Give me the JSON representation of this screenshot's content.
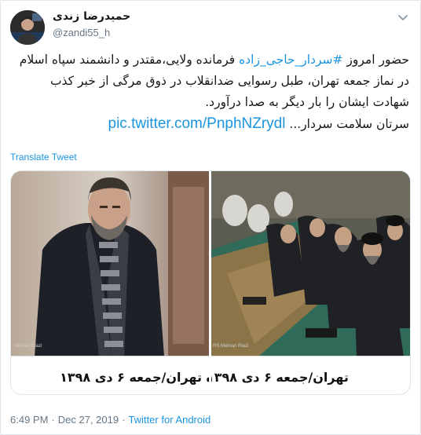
{
  "author": {
    "name": "حمیدرضا زندی",
    "handle": "@zandi55_h"
  },
  "tweet": {
    "part1": "حضور امروز ",
    "hashtag": "#سردار_حاجی_زاده",
    "part2": " فرمانده ولایی،مقتدر و دانشمند سپاه اسلام در نماز جمعه تهران، طبل رسوایی ضدانقلاب در ذوق مرگی از خبر کذب شهادت ایشان را بار دیگر به صدا درآورد.",
    "part3": "سرتان سلامت سردار... ",
    "link": "pic.twitter.com/PnphNZrydl"
  },
  "translate_label": "Translate Tweet",
  "media": {
    "left_caption": "ه تهران/جمعه ۶ دی ۱۳۹۸",
    "right_caption": "تهران/جمعه ۶ دی ۱۳۹۸",
    "left_credit": "Mehran Riazi",
    "right_credit": "RS Mehran Riazi"
  },
  "footer": {
    "time": "6:49 PM",
    "date": "Dec 27, 2019",
    "separator": "·",
    "app": "Twitter for Android"
  },
  "colors": {
    "link": "#1b95e0",
    "muted": "#657786",
    "border": "#e1e8ed"
  }
}
